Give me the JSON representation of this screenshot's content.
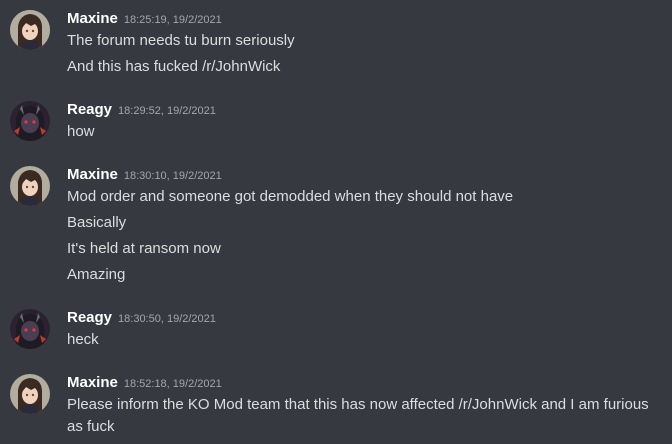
{
  "messages": [
    {
      "username": "Maxine",
      "timestamp": "18:25:19, 19/2/2021",
      "avatar_icon": "maxine-avatar",
      "lines": [
        "The forum needs tu burn seriously",
        "And this has fucked /r/JohnWick"
      ]
    },
    {
      "username": "Reagy",
      "timestamp": "18:29:52, 19/2/2021",
      "avatar_icon": "reagy-avatar",
      "lines": [
        "how"
      ]
    },
    {
      "username": "Maxine",
      "timestamp": "18:30:10, 19/2/2021",
      "avatar_icon": "maxine-avatar",
      "lines": [
        "Mod order and someone got demodded when they should not have",
        "Basically",
        "It's held at ransom now",
        "Amazing"
      ]
    },
    {
      "username": "Reagy",
      "timestamp": "18:30:50, 19/2/2021",
      "avatar_icon": "reagy-avatar",
      "lines": [
        "heck"
      ]
    },
    {
      "username": "Maxine",
      "timestamp": "18:52:18, 19/2/2021",
      "avatar_icon": "maxine-avatar",
      "lines": [
        "Please inform the KO Mod team that this has now affected /r/JohnWick and I am furious as fuck"
      ]
    }
  ],
  "colors": {
    "background": "#36393f",
    "username": "#ffffff",
    "timestamp": "#a3a6aa",
    "text": "#dcddde"
  }
}
